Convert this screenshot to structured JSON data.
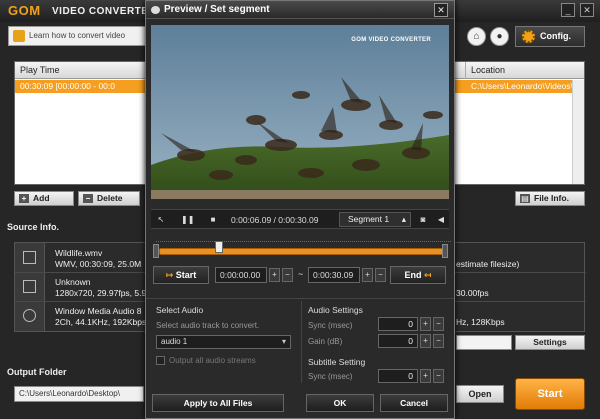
{
  "app": {
    "logo": "GOM",
    "logo_sub": "VIDEO CONVERTER",
    "tip": "Learn how to convert video",
    "config_label": "Config.",
    "minimize": "_",
    "close": "✕"
  },
  "list": {
    "col_play_time": "Play Time",
    "col_location": "Location",
    "row_play_time": "00:30:09 [00:00:00 - 00:0",
    "row_location": "C:\\Users\\Leonardo\\Videos\\"
  },
  "list_buttons": {
    "add": "Add",
    "delete": "Delete",
    "file_info": "File Info."
  },
  "source": {
    "title": "Source Info.",
    "file_line1": "Wildlife.wmv",
    "file_line2": "WMV, 00:30:09, 25.0M",
    "file_right": "estimate filesize)",
    "video_line1": "Unknown",
    "video_line2": "1280x720, 29.97fps, 5.9",
    "video_right": "30.00fps",
    "audio_line1": "Window Media Audio 8",
    "audio_line2": "2Ch, 44.1KHz, 192Kbps",
    "audio_right": "Hz, 128Kbps",
    "settings": "Settings"
  },
  "output": {
    "title": "Output Folder",
    "path": "C:\\Users\\Leonardo\\Desktop\\",
    "open": "Open",
    "start": "Start"
  },
  "dialog": {
    "title": "Preview / Set segment",
    "close": "✕",
    "video_brand": "GOM VIDEO CONVERTER",
    "time_display": "0:00:06.09 / 0:00:30.09",
    "segment": "Segment 1",
    "start_label": "Start",
    "start_time": "0:00:00.00",
    "end_time": "0:00:30.09",
    "end_label": "End",
    "tilde": "~",
    "select_audio": "Select Audio",
    "select_audio_hint": "Select audio track to convert.",
    "audio_track": "audio 1",
    "output_all": "Output all audio streams",
    "audio_settings": "Audio Settings",
    "sync_label": "Sync (msec)",
    "sync_value": "0",
    "gain_label": "Gain (dB)",
    "gain_value": "0",
    "subtitle_setting": "Subtitle Setting",
    "sub_sync_label": "Sync (msec)",
    "sub_sync_value": "0",
    "apply_all": "Apply to All Files",
    "ok": "OK",
    "cancel": "Cancel",
    "plus": "+",
    "minus": "−"
  },
  "colors": {
    "accent": "#f59e1f",
    "brand": "#f1a21b"
  }
}
